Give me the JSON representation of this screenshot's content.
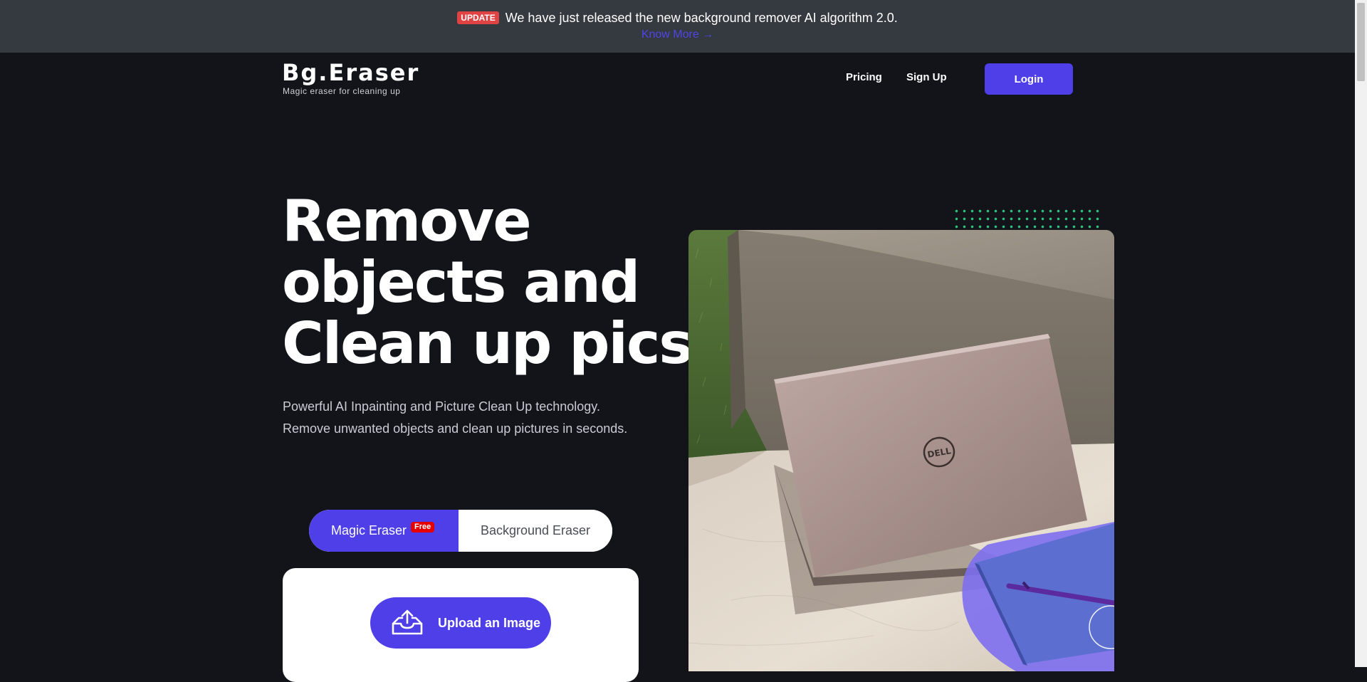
{
  "announcement": {
    "badge": "UPDATE",
    "message": "We have just released the new background remover AI algorithm 2.0.",
    "link": "Know More →"
  },
  "header": {
    "logo": "Bg.Eraser",
    "tagline": "Magic eraser for cleaning up",
    "nav": {
      "pricing": "Pricing",
      "signup": "Sign Up",
      "login": "Login"
    }
  },
  "hero": {
    "title_lines": [
      "Remove",
      "objects and",
      "Clean up pics."
    ],
    "description": "Powerful AI Inpainting and Picture Clean Up technology. Remove unwanted objects and clean up pictures in seconds."
  },
  "tools": {
    "magic": "Magic Eraser",
    "free_badge": "Free",
    "background": "Background Eraser"
  },
  "upload": {
    "label": "Upload an Image",
    "icon": "upload-tray-icon"
  },
  "image": {
    "brand_mark": "DELL"
  },
  "colors": {
    "background": "#12141a",
    "announcement_bg": "#353940",
    "accent": "#4f3fe8",
    "link": "#4f46e5",
    "badge_red": "#e04343",
    "dots": "#2ec27e"
  }
}
